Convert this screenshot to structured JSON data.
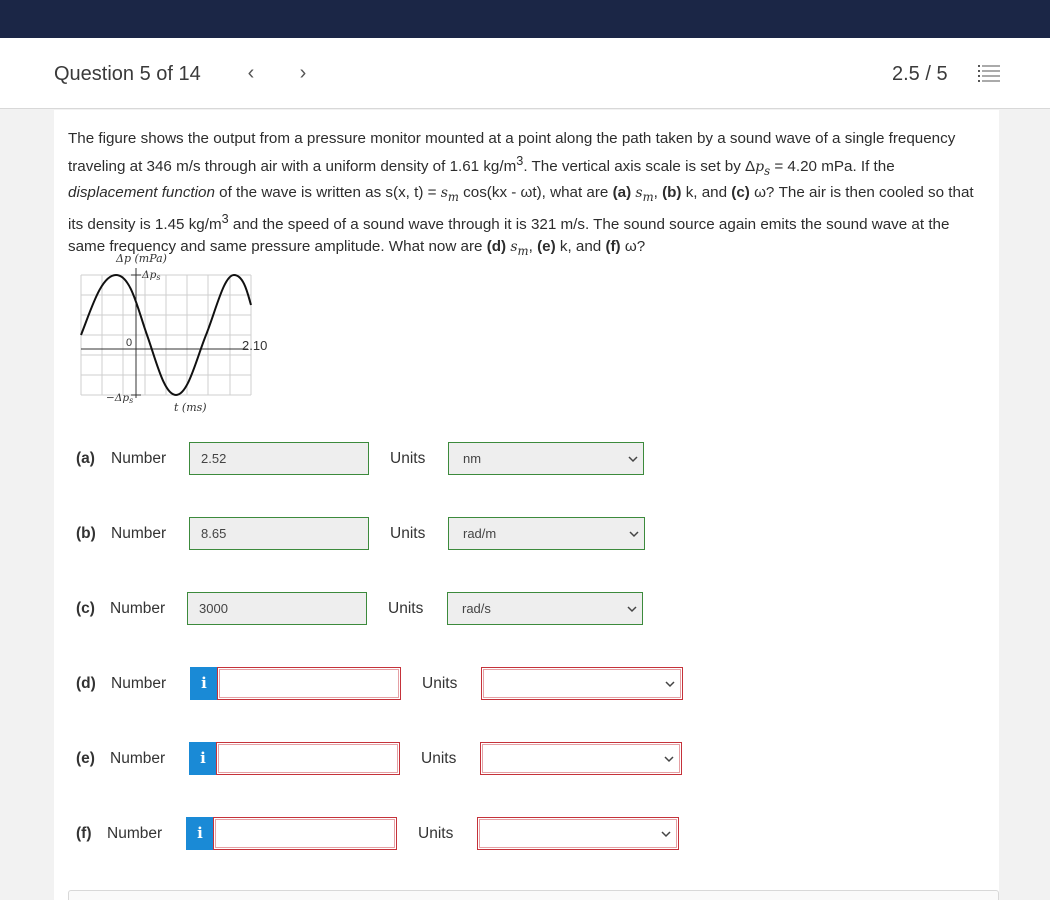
{
  "header": {
    "question_label": "Question 5 of 14",
    "prev_icon": "‹",
    "next_icon": "›",
    "score": "2.5 / 5"
  },
  "question": {
    "p1": "The figure shows the output from a pressure monitor mounted at a point along the path taken by a sound wave of a single frequency traveling at 346 m/s through air with a uniform density of 1.61 kg/m",
    "p2": ". The vertical axis scale is set by Δ",
    "p3": " = 4.20 mPa. If the ",
    "p4": "displacement function",
    "p5": " of the wave is written as s(x, t) = ",
    "p6": " cos(kx - ωt), what are ",
    "a": "(a)",
    "b": "(b)",
    "c": "(c)",
    "d": "(d)",
    "e": "(e)",
    "f": "(f)",
    "p7": " k, and ",
    "p8": " ω? The air is then cooled so that its density is 1.45 kg/m",
    "p9": " and the speed of a sound wave through it is 321 m/s. The sound source again emits the sound wave at the same frequency and same pressure amplitude. What now are ",
    "p10": " k, and ",
    "p11": " ω?"
  },
  "figure": {
    "ylabel": "Δp (mPa)",
    "top_label": "Δp",
    "bottom_label": "−Δp",
    "sub_s": "s",
    "zero": "0",
    "x_end": "2.10",
    "xlabel": "t (ms)"
  },
  "answers": [
    {
      "part": "(a)",
      "label": "Number",
      "value": "2.52",
      "units_label": "Units",
      "unit": "nm"
    },
    {
      "part": "(b)",
      "label": "Number",
      "value": "8.65",
      "units_label": "Units",
      "unit": "rad/m"
    },
    {
      "part": "(c)",
      "label": "Number",
      "value": "3000",
      "units_label": "Units",
      "unit": "rad/s"
    },
    {
      "part": "(d)",
      "label": "Number",
      "info": "i",
      "units_label": "Units"
    },
    {
      "part": "(e)",
      "label": "Number",
      "info": "i",
      "units_label": "Units"
    },
    {
      "part": "(f)",
      "label": "Number",
      "info": "i",
      "units_label": "Units"
    }
  ],
  "colors": {
    "topbar": "#1b2646",
    "correct_border": "#3c8a3c",
    "error_border": "#c5323a",
    "info_button": "#1a8ad6"
  }
}
